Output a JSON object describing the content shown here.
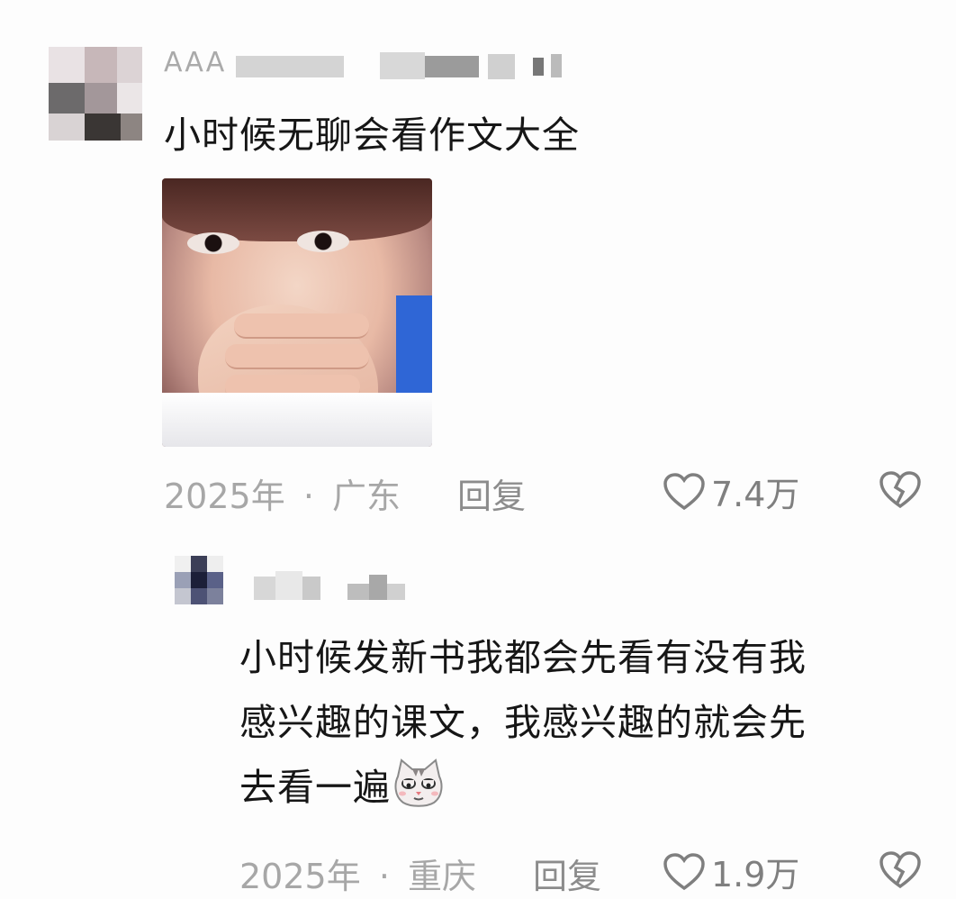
{
  "comment1": {
    "username": "AAA",
    "text": "小时候无聊会看作文大全",
    "time": "2025年",
    "location": "广东",
    "separator": "·",
    "reply_label": "回复",
    "likes": "7.4万"
  },
  "comment2": {
    "text_line1": "小时候发新书我都会先看有没有我",
    "text_line2": "感兴趣的课文，我感兴趣的就会先",
    "text_line3": "去看一遍",
    "emoji": "cat-emoji",
    "time": "2025年",
    "location": "重庆",
    "separator": "·",
    "reply_label": "回复",
    "likes": "1.9万"
  },
  "icons": {
    "like": "heart-outline-icon",
    "dislike": "broken-heart-icon"
  },
  "colors": {
    "background": "#fdfdfd",
    "text": "#161616",
    "meta": "#a7a7a7"
  }
}
